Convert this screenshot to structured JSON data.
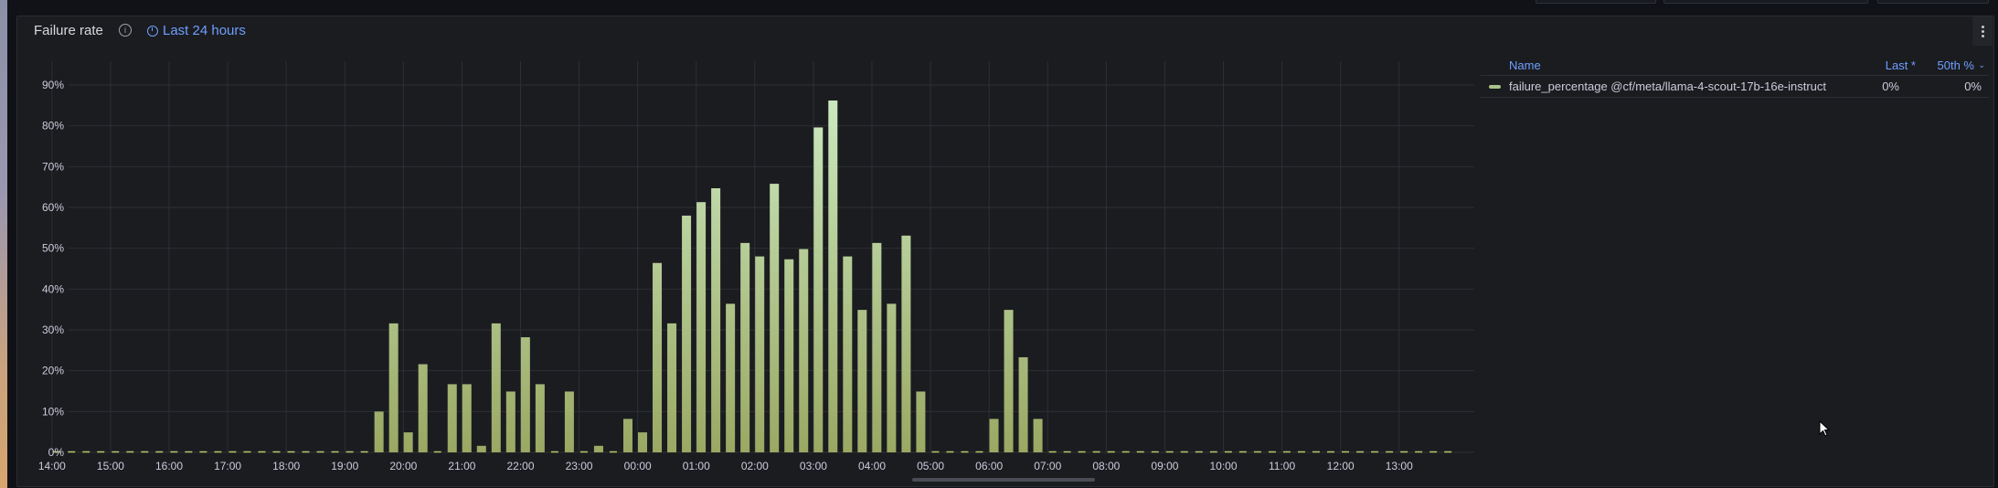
{
  "panel": {
    "title": "Failure rate",
    "info_icon": "info-circle-icon",
    "time_range_icon": "clock-icon",
    "time_range": "Last 24 hours",
    "menu_icon": "kebab-menu-icon"
  },
  "colors": {
    "accent": "#6e9fff",
    "bar_bottom": "#9aa862",
    "bar_top": "#cdebc3",
    "zero": "#b8c76a",
    "grid": "#2c2f35",
    "series": "#a9c38a"
  },
  "legend": {
    "headers": {
      "name": "Name",
      "last": "Last *",
      "p50": "50th %",
      "sort_icon": "chevron-down-icon"
    },
    "rows": [
      {
        "name": "failure_percentage @cf/meta/llama-4-scout-17b-16e-instruct",
        "last": "0%",
        "p50": "0%"
      }
    ]
  },
  "chart_data": {
    "type": "bar",
    "xlabel": "",
    "ylabel": "",
    "ylim": [
      0,
      90
    ],
    "y_ticks": [
      "0%",
      "10%",
      "20%",
      "30%",
      "40%",
      "50%",
      "60%",
      "70%",
      "80%",
      "90%"
    ],
    "x_ticks": [
      "15:00",
      "16:00",
      "17:00",
      "18:00",
      "19:00",
      "20:00",
      "21:00",
      "22:00",
      "23:00",
      "00:00",
      "01:00",
      "02:00",
      "03:00",
      "04:00",
      "05:00",
      "06:00",
      "07:00",
      "08:00",
      "09:00",
      "10:00",
      "11:00",
      "12:00",
      "13:00",
      "14:00"
    ],
    "grid": true,
    "legend_placement": "right",
    "series": [
      {
        "name": "failure_percentage @cf/meta/llama-4-scout-17b-16e-instruct",
        "x": [
          "14:15",
          "14:30",
          "14:45",
          "15:00",
          "15:15",
          "15:30",
          "15:45",
          "16:00",
          "16:15",
          "16:30",
          "16:45",
          "17:00",
          "17:15",
          "17:30",
          "17:45",
          "18:00",
          "18:15",
          "18:30",
          "18:45",
          "19:00",
          "19:15",
          "19:30",
          "19:45",
          "20:00",
          "20:15",
          "20:30",
          "20:45",
          "21:00",
          "21:15",
          "21:30",
          "21:45",
          "22:00",
          "22:15",
          "22:30",
          "22:45",
          "23:00",
          "23:15",
          "23:30",
          "23:45",
          "00:00",
          "00:15",
          "00:30",
          "00:45",
          "01:00",
          "01:15",
          "01:30",
          "01:45",
          "02:00",
          "02:15",
          "02:30",
          "02:45",
          "03:00",
          "03:15",
          "03:30",
          "03:45",
          "04:00",
          "04:15",
          "04:30",
          "04:45",
          "05:00",
          "05:15",
          "05:30",
          "05:45",
          "06:00",
          "06:15",
          "06:30",
          "06:45",
          "07:00",
          "07:15",
          "07:30",
          "07:45",
          "08:00",
          "08:15",
          "08:30",
          "08:45",
          "09:00",
          "09:15",
          "09:30",
          "09:45",
          "10:00",
          "10:15",
          "10:30",
          "10:45",
          "11:00",
          "11:15",
          "11:30",
          "11:45",
          "12:00",
          "12:15",
          "12:30",
          "12:45",
          "13:00",
          "13:15",
          "13:30",
          "13:45",
          "14:00"
        ],
        "values": [
          0,
          0,
          0,
          0,
          0,
          0,
          0,
          0,
          0,
          0,
          0,
          0,
          0,
          0,
          0,
          0,
          0,
          0,
          0,
          0,
          0,
          10,
          31.6,
          4.9,
          21.6,
          0,
          16.7,
          16.7,
          1.6,
          31.6,
          14.9,
          28.2,
          16.7,
          0,
          14.9,
          0,
          1.6,
          0,
          8.2,
          4.9,
          46.4,
          31.6,
          58,
          61.3,
          64.7,
          36.4,
          51.3,
          48,
          65.8,
          47.3,
          49.8,
          79.6,
          86.2,
          48,
          34.9,
          51.3,
          36.4,
          53.1,
          14.9,
          0,
          0,
          0,
          0,
          8.2,
          34.9,
          23.3,
          8.2,
          0,
          0,
          0,
          0,
          0,
          0,
          0,
          0,
          0,
          0,
          0,
          0,
          0,
          0,
          0,
          0,
          0,
          0,
          0,
          0,
          0,
          0,
          0,
          0,
          0,
          0,
          0,
          0,
          0
        ]
      }
    ]
  }
}
